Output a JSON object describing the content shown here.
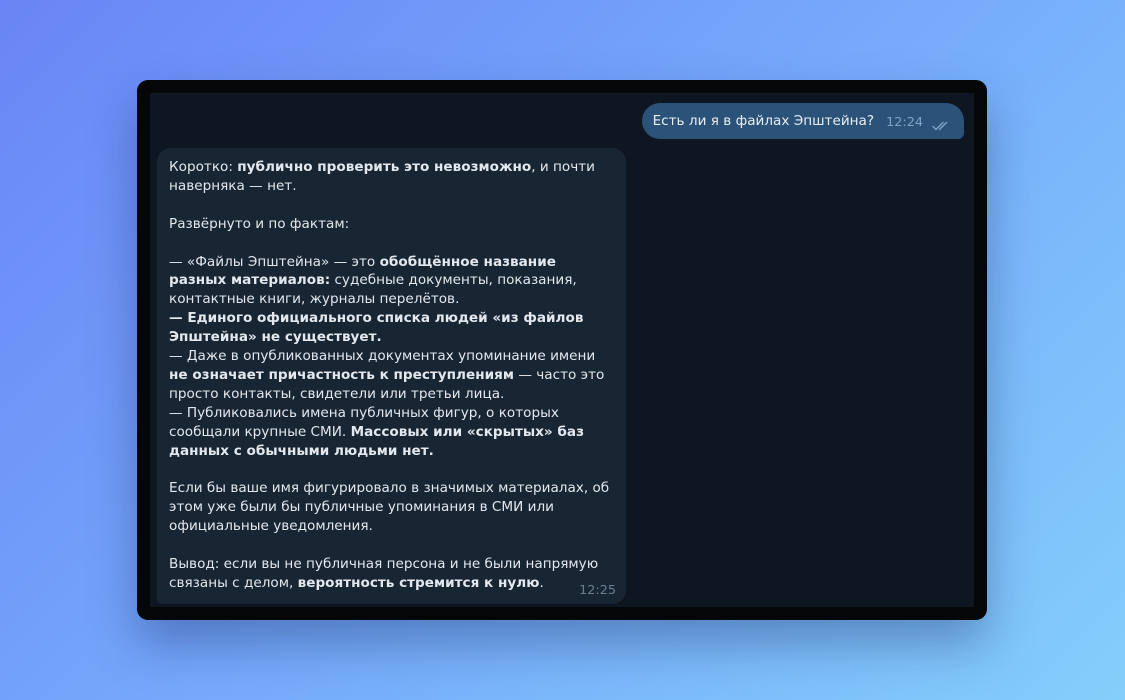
{
  "messages": {
    "outgoing": {
      "text": "Есть ли я в файлах Эпштейна?",
      "time": "12:24",
      "status_icon": "double-check-icon"
    },
    "incoming": {
      "time": "12:25",
      "p1": {
        "a": "Коротко: ",
        "b": "публично проверить это невозможно",
        "c": ", и почти наверняка — нет."
      },
      "p2": "Развёрнуто и по фактам:",
      "p3": {
        "l1a": "— «Файлы Эпштейна» — это ",
        "l1b": "обобщённое название разных материалов:",
        "l1c": " судебные документы, показания, контактные книги, журналы перелётов.",
        "l2": "— Единого официального списка людей «из файлов Эпштейна» не существует.",
        "l3a": "— Даже в опубликованных документах упоминание имени ",
        "l3b": "не означает причастность к преступлениям",
        "l3c": " — часто это просто контакты, свидетели или третьи лица.",
        "l4a": "— Публиковались имена публичных фигур, о которых сообщали крупные СМИ. ",
        "l4b": "Массовых или «скрытых» баз данных с обычными людьми нет."
      },
      "p4": "Если бы ваше имя фигурировало в значимых материалах, об этом уже были бы публичные упоминания в СМИ или официальные уведомления.",
      "p5": {
        "a": "Вывод: если вы не публичная персона и не были напрямую связаны с делом, ",
        "b": "вероятность стремится к нулю",
        "c": "."
      }
    }
  },
  "colors": {
    "background_gradient": [
      "#6a85f5",
      "#84cefb"
    ],
    "chat_bg": "#0e1621",
    "outgoing_bubble": "#2b5278",
    "incoming_bubble": "#182533"
  }
}
